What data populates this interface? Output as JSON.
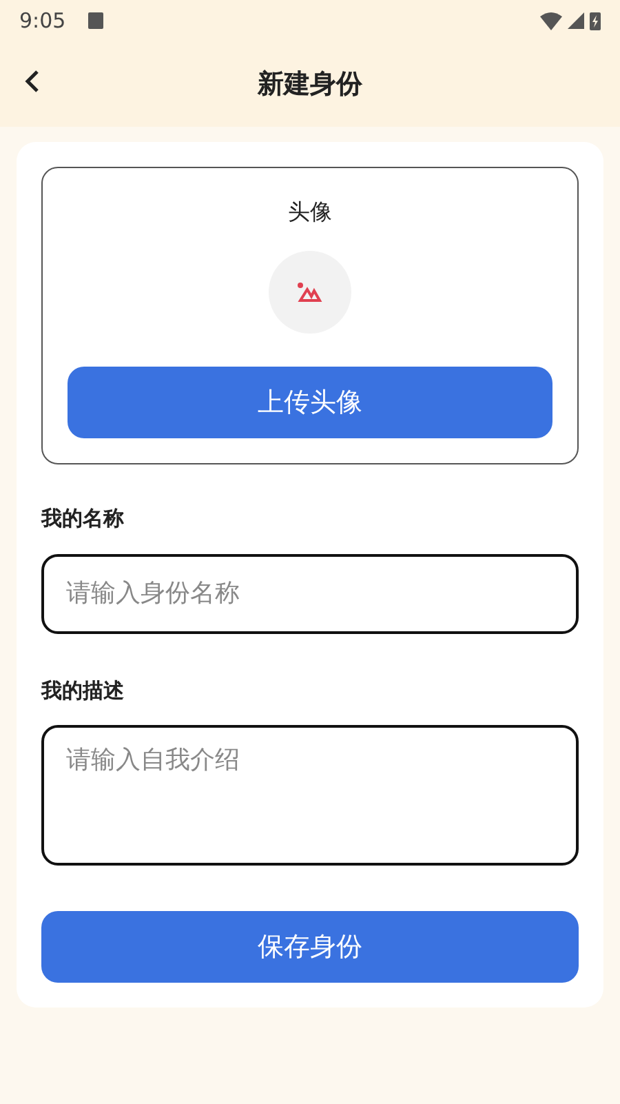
{
  "status_bar": {
    "time": "9:05"
  },
  "header": {
    "title": "新建身份"
  },
  "avatar": {
    "label": "头像",
    "button": "上传头像"
  },
  "fields": [
    {
      "kind": "input",
      "label": "我的名称",
      "placeholder": "请输入身份名称"
    },
    {
      "kind": "textarea",
      "label": "我的描述",
      "placeholder": "请输入自我介绍"
    }
  ],
  "save_button": "保存身份"
}
